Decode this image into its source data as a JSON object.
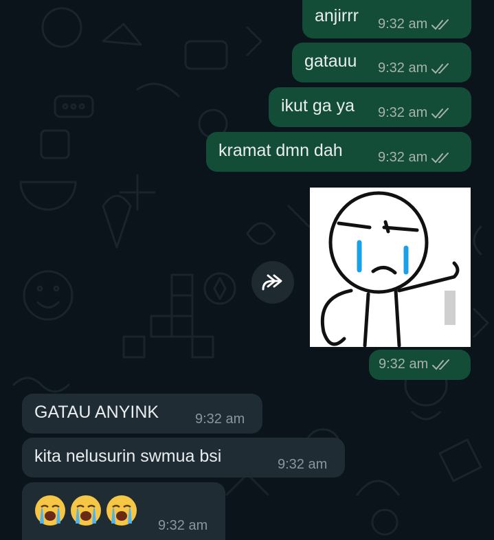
{
  "chat": {
    "outgoing": [
      {
        "text": "anjirrr",
        "time": "9:32 am"
      },
      {
        "text": "gatauu",
        "time": "9:32 am"
      },
      {
        "text": "ikut ga ya",
        "time": "9:32 am"
      },
      {
        "text": "kramat dmn dah",
        "time": "9:32 am"
      }
    ],
    "sticker_message": {
      "time": "9:32 am",
      "sticker": "crying-stickman-sticker"
    },
    "incoming": [
      {
        "text": "GATAU ANYINK",
        "time": "9:32 am"
      },
      {
        "text": "kita nelusurin swmua bsi",
        "time": "9:32 am"
      },
      {
        "text": "",
        "emoji": [
          "loudly-crying-face",
          "loudly-crying-face",
          "loudly-crying-face"
        ],
        "time": "9:32 am"
      }
    ]
  },
  "icons": {
    "read_receipt": "double-check-icon",
    "forward": "forward-icon"
  },
  "colors": {
    "background": "#0b141a",
    "outgoing_bubble": "#144d37",
    "incoming_bubble": "#202c33",
    "text": "#e9edef",
    "meta_text": "#a6b2ad",
    "read_ticks": "#a6b2ad"
  }
}
